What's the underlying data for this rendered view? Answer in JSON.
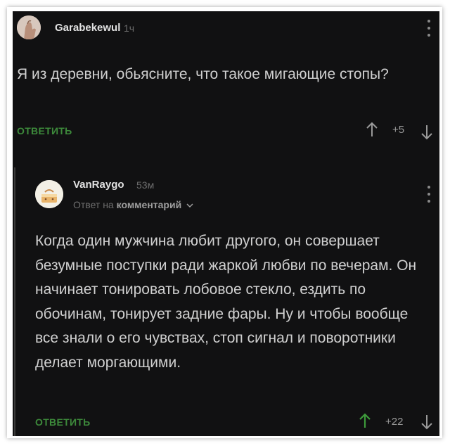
{
  "comment": {
    "username": "Garabekewul",
    "time": "1ч",
    "text": "Я из деревни, обьясните, что такое мигающие стопы?",
    "reply_label": "ОТВЕТИТЬ",
    "score": "+5"
  },
  "reply": {
    "username": "VanRaygo",
    "time": "53м",
    "meta_prefix": "Ответ на",
    "meta_link": "комментарий",
    "text": "Когда один мужчина любит другого, он совершает безумные поступки ради жаркой любви по вечерам. Он начинает тонировать лобовое стекло, ездить по обочинам, тонирует задние фары. Ну и чтобы вообще все знали о его чувствах, стоп сигнал и поворотники делает моргающими.",
    "reply_label": "ОТВЕТИТЬ",
    "score": "+22"
  },
  "colors": {
    "background": "#111112",
    "accent_green": "#3d8a3b",
    "text": "#d0d0d0"
  }
}
